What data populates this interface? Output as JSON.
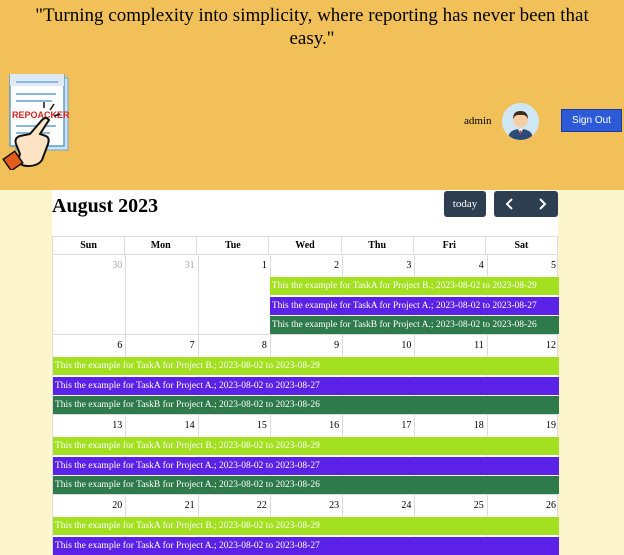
{
  "header": {
    "tagline": "\"Turning complexity into simplicity, where reporting has never been that easy.\"",
    "logo_text": "REPOACKER",
    "user_name": "admin",
    "sign_out_label": "Sign Out"
  },
  "calendar": {
    "title": "August 2023",
    "today_label": "today",
    "weekdays": [
      "Sun",
      "Mon",
      "Tue",
      "Wed",
      "Thu",
      "Fri",
      "Sat"
    ],
    "weeks": [
      {
        "days": [
          {
            "num": "30",
            "other": true
          },
          {
            "num": "31",
            "other": true
          },
          {
            "num": "1",
            "other": false
          },
          {
            "num": "2",
            "other": false
          },
          {
            "num": "3",
            "other": false
          },
          {
            "num": "4",
            "other": false
          },
          {
            "num": "5",
            "other": false
          }
        ],
        "events": [
          {
            "text": "This the example for TaskA for Project B.; 2023-08-02 to 2023-08-29",
            "color": "#a3e01f",
            "start": 3
          },
          {
            "text": "This the example for TaskA for Project A.; 2023-08-02 to 2023-08-27",
            "color": "#5b21e6",
            "start": 3
          },
          {
            "text": "This the example for TaskB for Project A.; 2023-08-02 to 2023-08-26",
            "color": "#2e7a4a",
            "start": 3
          }
        ]
      },
      {
        "days": [
          {
            "num": "6",
            "other": false
          },
          {
            "num": "7",
            "other": false
          },
          {
            "num": "8",
            "other": false
          },
          {
            "num": "9",
            "other": false
          },
          {
            "num": "10",
            "other": false
          },
          {
            "num": "11",
            "other": false
          },
          {
            "num": "12",
            "other": false
          }
        ],
        "events": [
          {
            "text": "This the example for TaskA for Project B.; 2023-08-02 to 2023-08-29",
            "color": "#a3e01f",
            "start": 0
          },
          {
            "text": "This the example for TaskA for Project A.; 2023-08-02 to 2023-08-27",
            "color": "#5b21e6",
            "start": 0
          },
          {
            "text": "This the example for TaskB for Project A.; 2023-08-02 to 2023-08-26",
            "color": "#2e7a4a",
            "start": 0
          }
        ]
      },
      {
        "days": [
          {
            "num": "13",
            "other": false
          },
          {
            "num": "14",
            "other": false
          },
          {
            "num": "15",
            "other": false
          },
          {
            "num": "16",
            "other": false
          },
          {
            "num": "17",
            "other": false
          },
          {
            "num": "18",
            "other": false
          },
          {
            "num": "19",
            "other": false
          }
        ],
        "events": [
          {
            "text": "This the example for TaskA for Project B.; 2023-08-02 to 2023-08-29",
            "color": "#a3e01f",
            "start": 0
          },
          {
            "text": "This the example for TaskA for Project A.; 2023-08-02 to 2023-08-27",
            "color": "#5b21e6",
            "start": 0
          },
          {
            "text": "This the example for TaskB for Project A.; 2023-08-02 to 2023-08-26",
            "color": "#2e7a4a",
            "start": 0
          }
        ]
      },
      {
        "days": [
          {
            "num": "20",
            "other": false
          },
          {
            "num": "21",
            "other": false
          },
          {
            "num": "22",
            "other": false
          },
          {
            "num": "23",
            "other": false
          },
          {
            "num": "24",
            "other": false
          },
          {
            "num": "25",
            "other": false
          },
          {
            "num": "26",
            "other": false
          }
        ],
        "events": [
          {
            "text": "This the example for TaskA for Project B.; 2023-08-02 to 2023-08-29",
            "color": "#a3e01f",
            "start": 0
          },
          {
            "text": "This the example for TaskA for Project A.; 2023-08-02 to 2023-08-27",
            "color": "#5b21e6",
            "start": 0
          }
        ]
      }
    ]
  }
}
